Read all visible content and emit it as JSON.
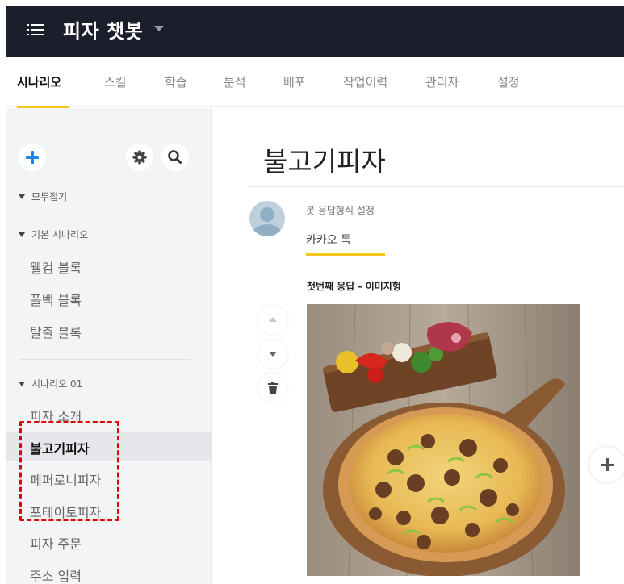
{
  "app": {
    "title": "피자 챗봇"
  },
  "tabs": [
    {
      "label": "시나리오",
      "active": true
    },
    {
      "label": "스킬"
    },
    {
      "label": "학습"
    },
    {
      "label": "분석"
    },
    {
      "label": "배포"
    },
    {
      "label": "작업이력"
    },
    {
      "label": "관리자"
    },
    {
      "label": "설정"
    }
  ],
  "sidebar": {
    "collapse_all": "모두접기",
    "sections": [
      {
        "label": "기본 시나리오",
        "items": [
          "웰컴 블록",
          "폴백 블록",
          "탈출 블록"
        ]
      },
      {
        "label": "시나리오 01",
        "items": [
          "피자 소개",
          "불고기피자",
          "페퍼로니피자",
          "포테이토피자",
          "피자 주문",
          "주소 입력"
        ]
      }
    ],
    "active_item": "불고기피자"
  },
  "content": {
    "block_title": "불고기피자",
    "bot_response_setting": "봇 응답형식 설정",
    "channel_tab": "카카오 톡",
    "response_label": "첫번째 응답 - 이미지형"
  },
  "colors": {
    "topbar": "#1d1e2b",
    "accent": "#f5c518",
    "link_blue": "#1a84e8",
    "highlight": "#e30000"
  },
  "icons": {
    "menu": "menu-icon",
    "caret": "chevron-down-icon",
    "add": "plus-icon",
    "settings": "gear-icon",
    "search": "search-icon",
    "move_up": "arrow-up-icon",
    "move_down": "arrow-down-icon",
    "delete": "trash-icon"
  }
}
